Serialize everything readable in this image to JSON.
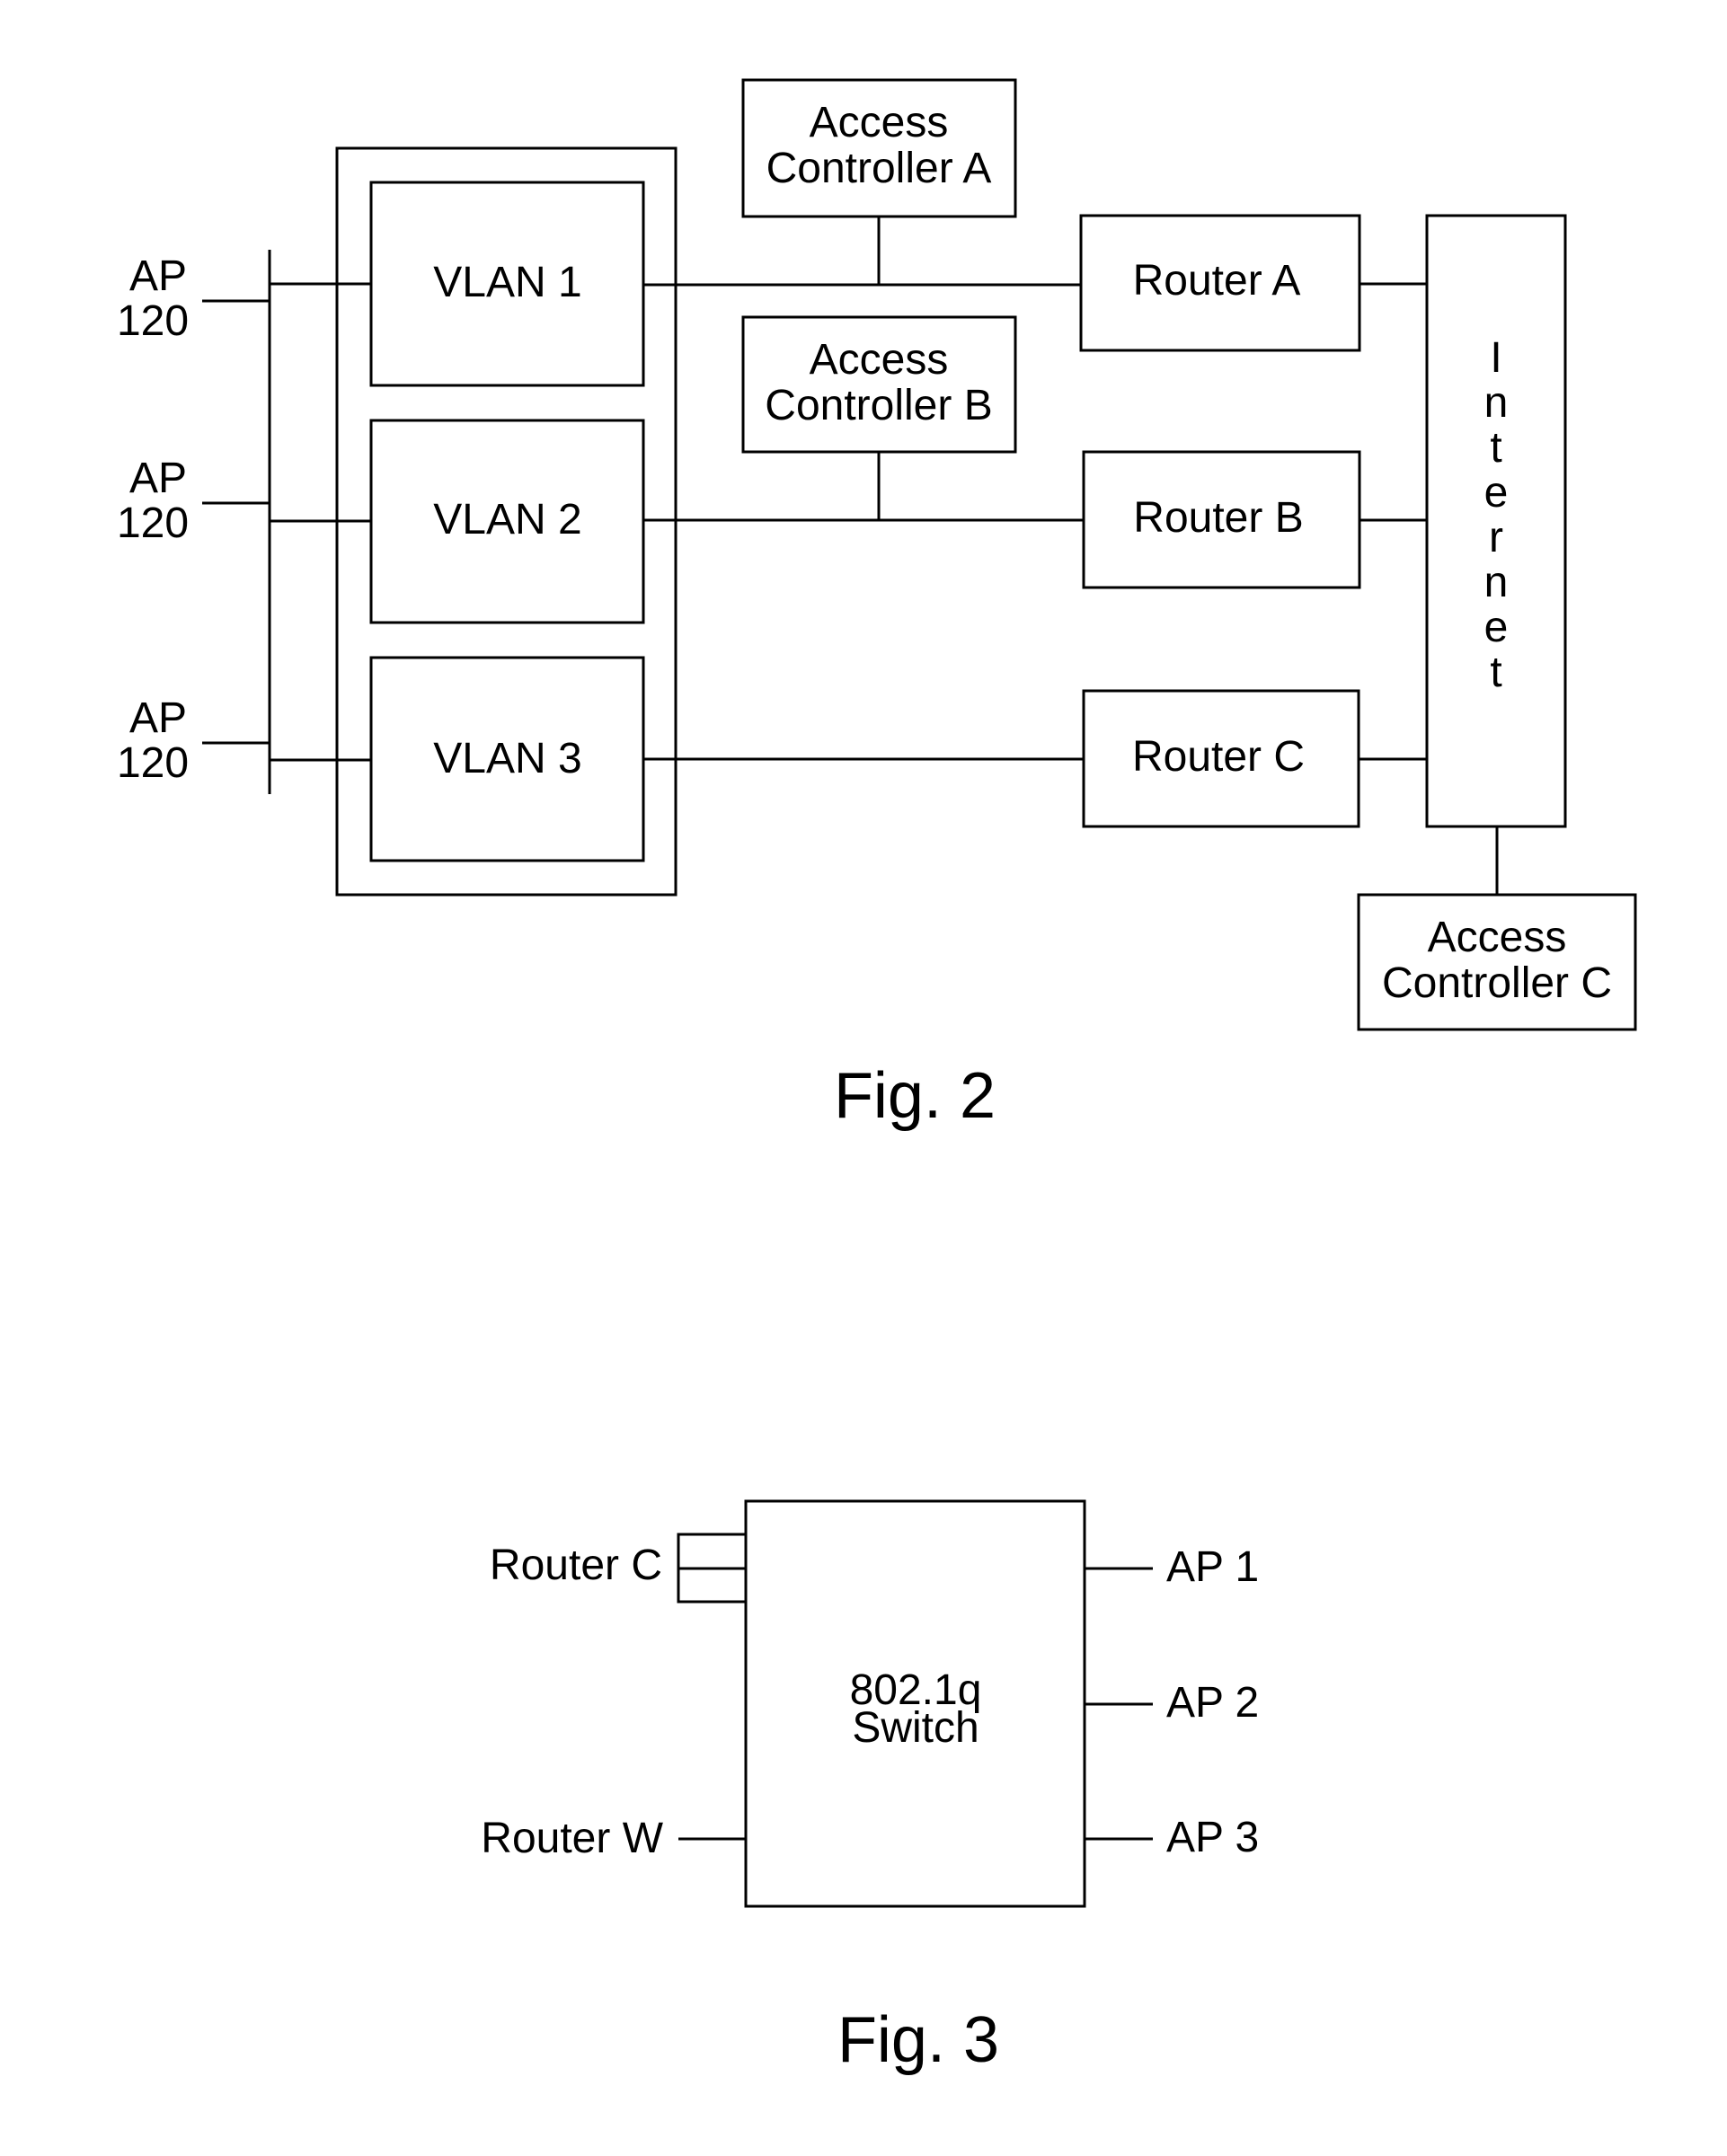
{
  "fig2": {
    "caption": "Fig. 2",
    "access_points": [
      {
        "line1": "AP",
        "line2": "120"
      },
      {
        "line1": "AP",
        "line2": "120"
      },
      {
        "line1": "AP",
        "line2": "120"
      }
    ],
    "vlans": [
      "VLAN 1",
      "VLAN 2",
      "VLAN 3"
    ],
    "access_controllers": [
      {
        "line1": "Access",
        "line2": "Controller A"
      },
      {
        "line1": "Access",
        "line2": "Controller B"
      },
      {
        "line1": "Access",
        "line2": "Controller C"
      }
    ],
    "routers": [
      "Router A",
      "Router B",
      "Router C"
    ],
    "internet": {
      "label": "Internet",
      "letters": [
        "I",
        "n",
        "t",
        "e",
        "r",
        "n",
        "e",
        "t"
      ]
    }
  },
  "fig3": {
    "caption": "Fig. 3",
    "switch": {
      "line1": "802.1q",
      "line2": "Switch"
    },
    "left_ports": [
      "Router C",
      "Router W"
    ],
    "right_ports": [
      "AP 1",
      "AP 2",
      "AP 3"
    ]
  }
}
